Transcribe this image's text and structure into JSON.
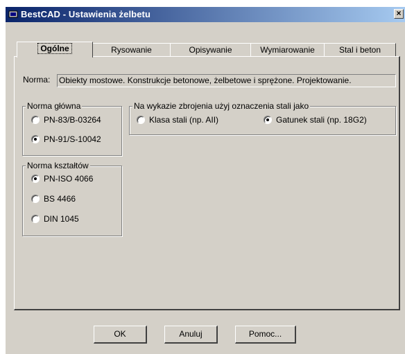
{
  "window": {
    "title": "BestCAD - Ustawienia żelbetu",
    "close_label": "×"
  },
  "tabs": [
    {
      "label": "Ogólne",
      "active": true
    },
    {
      "label": "Rysowanie",
      "active": false
    },
    {
      "label": "Opisywanie",
      "active": false
    },
    {
      "label": "Wymiarowanie",
      "active": false
    },
    {
      "label": "Stal i beton",
      "active": false
    }
  ],
  "norma": {
    "label": "Norma:",
    "value": "Obiekty mostowe. Konstrukcje betonowe, żelbetowe i sprężone. Projektowanie."
  },
  "norma_glowna": {
    "title": "Norma główna",
    "options": [
      {
        "label": "PN-83/B-03264",
        "checked": false
      },
      {
        "label": "PN-91/S-10042",
        "checked": true
      }
    ]
  },
  "wykaz": {
    "title": "Na wykazie zbrojenia użyj oznaczenia stali jako",
    "options": [
      {
        "label": "Klasa stali (np. AII)",
        "checked": false
      },
      {
        "label": "Gatunek stali (np. 18G2)",
        "checked": true
      }
    ]
  },
  "norma_ksztaltow": {
    "title": "Norma kształtów",
    "options": [
      {
        "label": "PN-ISO 4066",
        "checked": true
      },
      {
        "label": "BS 4466",
        "checked": false
      },
      {
        "label": "DIN 1045",
        "checked": false
      }
    ]
  },
  "buttons": {
    "ok": "OK",
    "cancel": "Anuluj",
    "help": "Pomoc..."
  },
  "colors": {
    "titlebar_start": "#0a246a",
    "titlebar_end": "#a6caf0",
    "face": "#d4d0c8"
  }
}
